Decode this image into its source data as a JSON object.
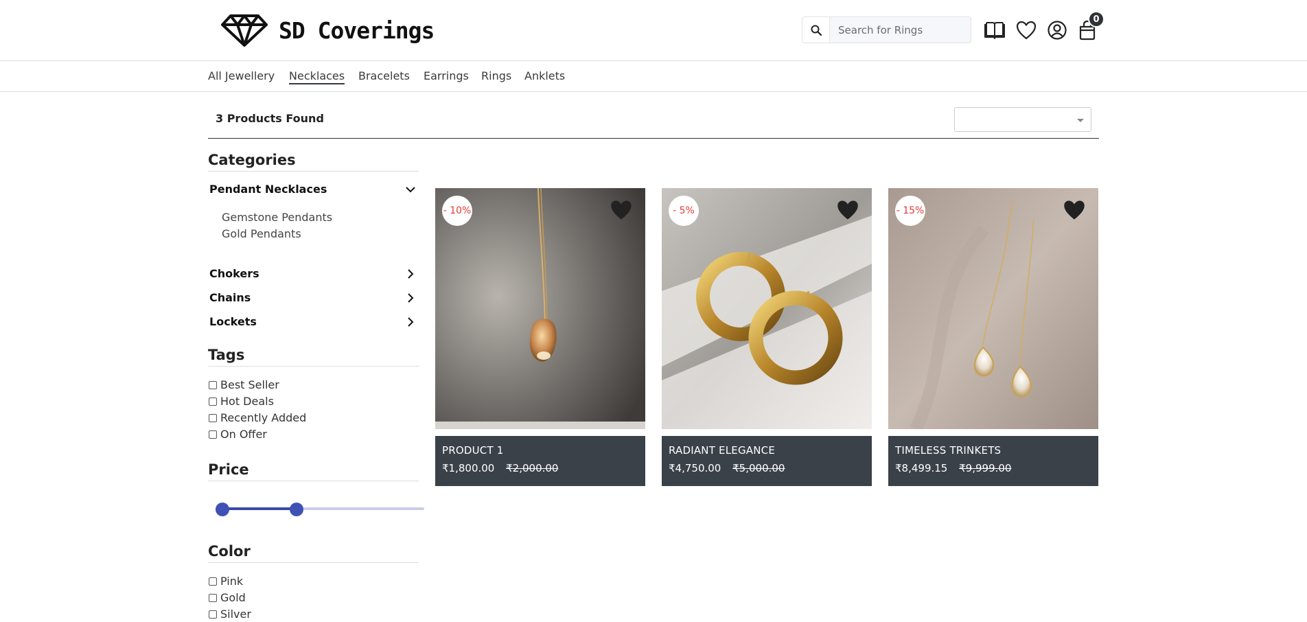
{
  "brand": {
    "name": "SD Coverings"
  },
  "search": {
    "placeholder": "Search for Rings"
  },
  "cart": {
    "count": "0"
  },
  "icons": {
    "search": "search-icon",
    "catalog": "book-icon",
    "wishlist": "heart-icon",
    "account": "user-icon",
    "cart": "shopping-bag-icon"
  },
  "nav": {
    "items": [
      {
        "label": "All Jewellery"
      },
      {
        "label": "Necklaces"
      },
      {
        "label": "Bracelets"
      },
      {
        "label": "Earrings"
      },
      {
        "label": "Rings"
      },
      {
        "label": "Anklets"
      }
    ],
    "active": "Necklaces"
  },
  "results": {
    "count_text": "3 Products Found",
    "sort_value": ""
  },
  "sidebar": {
    "categories_heading": "Categories",
    "categories": [
      {
        "label": "Pendant Necklaces",
        "expanded": true,
        "children": [
          "Gemstone Pendants",
          "Gold Pendants"
        ]
      },
      {
        "label": "Chokers",
        "expanded": false
      },
      {
        "label": "Chains",
        "expanded": false
      },
      {
        "label": "Lockets",
        "expanded": false
      }
    ],
    "tags_heading": "Tags",
    "tags": [
      "Best Seller",
      "Hot Deals",
      "Recently Added",
      "On Offer"
    ],
    "price_heading": "Price",
    "price_range": {
      "low_fraction": 0.0,
      "high_fraction": 0.38
    },
    "color_heading": "Color",
    "colors": [
      "Pink",
      "Gold",
      "Silver"
    ]
  },
  "products": [
    {
      "name": "PRODUCT 1",
      "price": "₹1,800.00",
      "old_price": "₹2,000.00",
      "discount": "- 10%"
    },
    {
      "name": "RADIANT ELEGANCE",
      "price": "₹4,750.00",
      "old_price": "₹5,000.00",
      "discount": "- 5%"
    },
    {
      "name": "TIMELESS TRINKETS",
      "price": "₹8,499.15",
      "old_price": "₹9,999.00",
      "discount": "- 15%"
    }
  ],
  "colors": {
    "accent": "#3f51b5",
    "card_info_bg": "#3a4149",
    "discount_text": "#e53935"
  }
}
